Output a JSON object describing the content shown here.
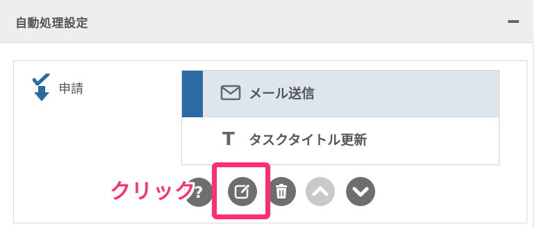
{
  "panel": {
    "title": "自動処理設定",
    "collapse_icon": "minus-icon"
  },
  "step": {
    "icon": "check-arrow-down-icon",
    "label": "申請"
  },
  "actions": [
    {
      "icon": "envelope-icon",
      "label": "メール送信",
      "selected": true
    },
    {
      "icon": "text-t-icon",
      "label": "タスクタイトル更新",
      "selected": false
    }
  ],
  "toolbar": {
    "buttons": [
      {
        "name": "help",
        "icon": "question-icon"
      },
      {
        "name": "edit",
        "icon": "edit-icon"
      },
      {
        "name": "delete",
        "icon": "trash-icon"
      },
      {
        "name": "move-up",
        "icon": "chevron-up-icon",
        "disabled": true
      },
      {
        "name": "move-down",
        "icon": "chevron-down-icon"
      }
    ]
  },
  "annotation": {
    "text": "クリック",
    "color": "#ff2f6e"
  },
  "colors": {
    "accent": "#2b6aa3",
    "selected_row_bg": "#dde6ee",
    "header_bg": "#eeeeee",
    "button": "#6e6e6e",
    "button_disabled": "#c9c9c9",
    "highlight": "#ff2f6e"
  }
}
